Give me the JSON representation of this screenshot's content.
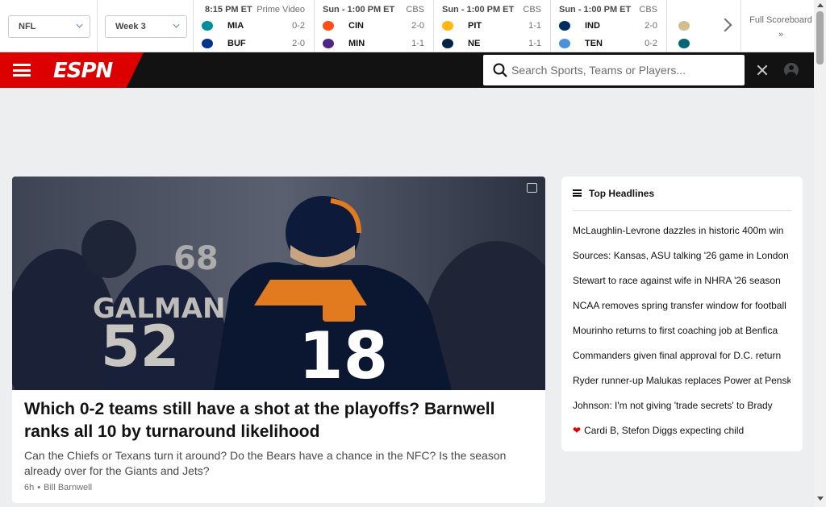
{
  "scoreboard": {
    "league_select": "NFL",
    "week_select": "Week 3",
    "games": [
      {
        "status": "8:15 PM ET",
        "network": "Prime Video",
        "teams": [
          {
            "abbr": "MIA",
            "record": "0-2",
            "color": "#008e97"
          },
          {
            "abbr": "BUF",
            "record": "2-0",
            "color": "#00338d"
          }
        ]
      },
      {
        "status": "Sun - 1:00 PM ET",
        "network": "CBS",
        "teams": [
          {
            "abbr": "CIN",
            "record": "2-0",
            "color": "#fb4f14"
          },
          {
            "abbr": "MIN",
            "record": "1-1",
            "color": "#4f2683"
          }
        ]
      },
      {
        "status": "Sun - 1:00 PM ET",
        "network": "CBS",
        "teams": [
          {
            "abbr": "PIT",
            "record": "1-1",
            "color": "#ffb612"
          },
          {
            "abbr": "NE",
            "record": "1-1",
            "color": "#002244"
          }
        ]
      },
      {
        "status": "Sun - 1:00 PM ET",
        "network": "CBS",
        "teams": [
          {
            "abbr": "IND",
            "record": "2-0",
            "color": "#002c5f"
          },
          {
            "abbr": "TEN",
            "record": "0-2",
            "color": "#4b92db"
          }
        ]
      }
    ],
    "full_scoreboard": "Full Scoreboard »"
  },
  "header": {
    "logo": "ESPN",
    "search_placeholder": "Search Sports, Teams or Players..."
  },
  "hero": {
    "title": "Which 0-2 teams still have a shot at the playoffs? Barnwell ranks all 10 by turnaround likelihood",
    "description": "Can the Chiefs or Texans turn it around? Do the Bears have a chance in the NFC? Is the season already over for the Giants and Jets?",
    "age": "6h",
    "author": "Bill Barnwell",
    "jersey_numbers": [
      "18",
      "52",
      "68"
    ],
    "jersey_name": "GALMAN"
  },
  "headlines": {
    "title": "Top Headlines",
    "items": [
      "McLaughlin-Levrone dazzles in historic 400m win",
      "Sources: Kansas, ASU talking '26 game in London",
      "Stewart to race against wife in NHRA '26 season",
      "NCAA removes spring transfer window for football",
      "Mourinho returns to first coaching job at Benfica",
      "Commanders given final approval for D.C. return",
      "Ryder runner-up Malukas replaces Power at Penske",
      "Johnson: I'm not giving 'trade secrets' to Brady",
      "Cardi B, Stefon Diggs expecting child"
    ]
  }
}
